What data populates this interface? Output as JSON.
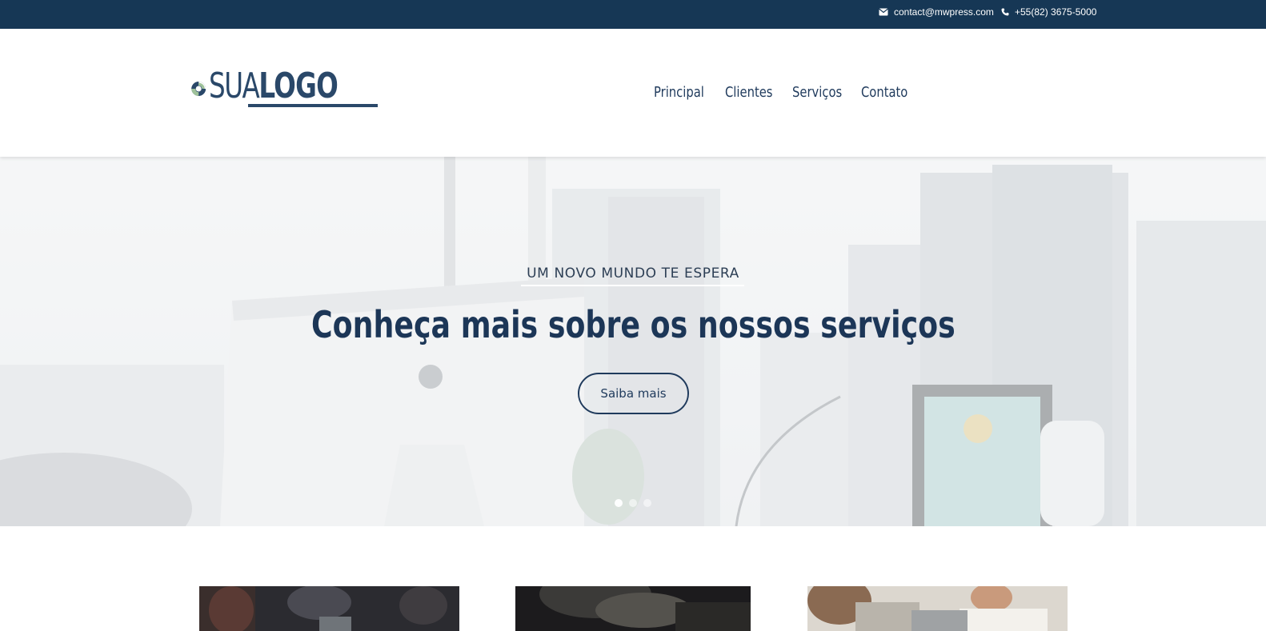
{
  "topbar": {
    "email": "contact@mwpress.com",
    "phone": "+55(82) 3675-5000",
    "email_icon": "envelope-icon",
    "phone_icon": "phone-icon",
    "bg_color": "#163755"
  },
  "header": {
    "logo": {
      "part1": "SUA",
      "part2": "LOGO"
    },
    "nav": [
      {
        "label": "Principal"
      },
      {
        "label": "Clientes"
      },
      {
        "label": "Serviços"
      },
      {
        "label": "Contato"
      }
    ]
  },
  "hero": {
    "kicker": "UM NOVO MUNDO TE ESPERA",
    "title": "Conheça mais sobre os nossos serviços",
    "button_label": "Saiba mais",
    "slides_count": 3,
    "active_slide": 1,
    "text_color": "#1c3657"
  },
  "cards": [
    {
      "image": "people-working-photo"
    },
    {
      "image": "person-with-laptop-photo"
    },
    {
      "image": "meeting-photo"
    }
  ]
}
